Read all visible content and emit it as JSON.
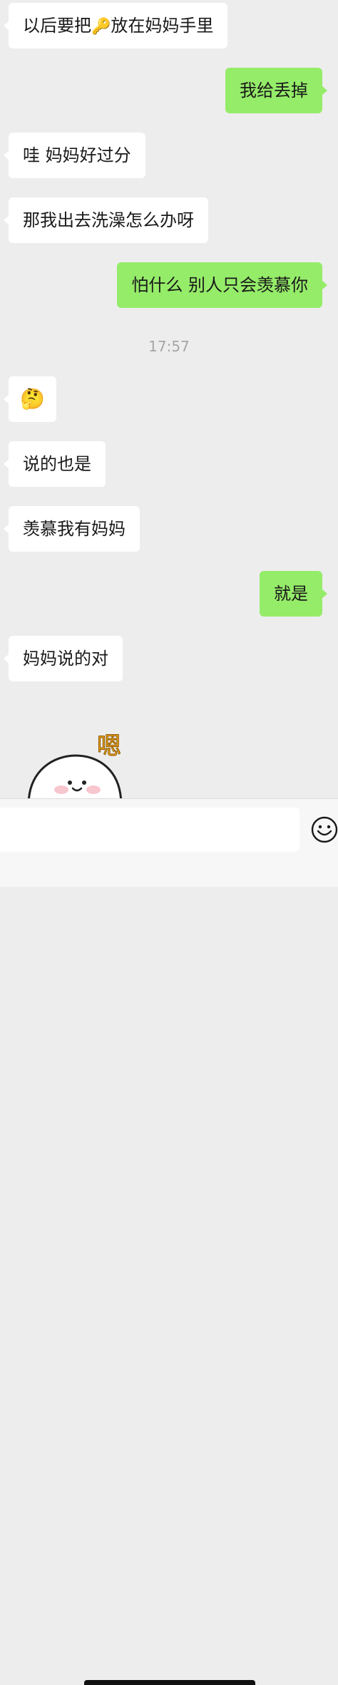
{
  "messages": [
    {
      "side": "left",
      "text_before": "以后要把",
      "emoji": "🔑",
      "text_after": "放在妈妈手里"
    },
    {
      "side": "right",
      "text": "我给丢掉"
    },
    {
      "side": "left",
      "text": "哇  妈妈好过分"
    },
    {
      "side": "left",
      "text": "那我出去洗澡怎么办呀"
    },
    {
      "side": "right",
      "text": "怕什么 别人只会羡慕你"
    },
    {
      "side": "left",
      "emoji": "🤔"
    },
    {
      "side": "left",
      "text": "说的也是"
    },
    {
      "side": "left",
      "text": "羡慕我有妈妈"
    },
    {
      "side": "right",
      "text": "就是"
    },
    {
      "side": "left",
      "text": "妈妈说的对"
    }
  ],
  "timestamp": "17:57",
  "sticker": {
    "caption": "嗯",
    "icon": "smiling-bun-sticker"
  },
  "input": {
    "value": "",
    "placeholder": ""
  },
  "colors": {
    "background": "#ededed",
    "left_bubble": "#ffffff",
    "right_bubble": "#95ec69",
    "timestamp": "#a6a6a6",
    "sticker_caption": "#f4a31a"
  }
}
